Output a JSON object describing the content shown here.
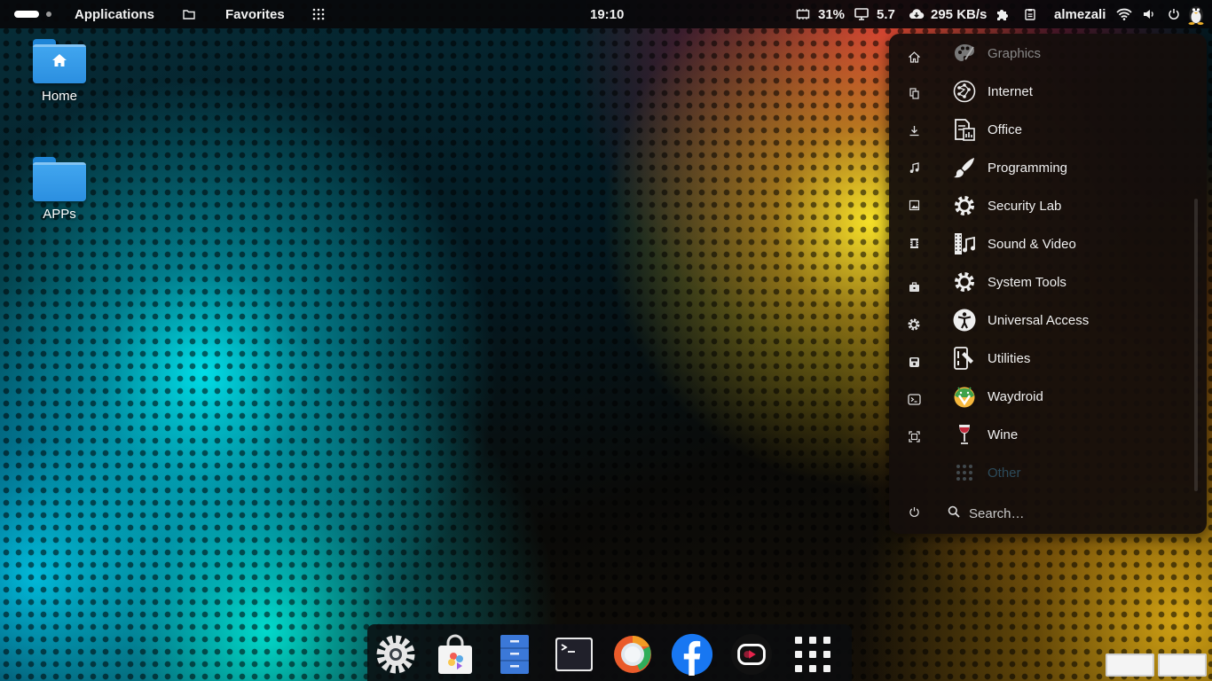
{
  "topbar": {
    "applications_label": "Applications",
    "favorites_label": "Favorites",
    "clock": "19:10",
    "battery_value": "31%",
    "display_value": "5.7",
    "network_speed": "295 KB/s",
    "username": "almezali"
  },
  "desktop": {
    "icons": [
      {
        "label": "Home"
      },
      {
        "label": "APPs"
      }
    ]
  },
  "menu": {
    "categories": [
      {
        "label": "Graphics",
        "icon": "palette-icon"
      },
      {
        "label": "Internet",
        "icon": "network-icon"
      },
      {
        "label": "Office",
        "icon": "office-icon"
      },
      {
        "label": "Programming",
        "icon": "brush-icon"
      },
      {
        "label": "Security Lab",
        "icon": "gear-icon"
      },
      {
        "label": "Sound & Video",
        "icon": "media-icon"
      },
      {
        "label": "System Tools",
        "icon": "gear-icon"
      },
      {
        "label": "Universal Access",
        "icon": "accessibility-icon"
      },
      {
        "label": "Utilities",
        "icon": "utilities-icon"
      },
      {
        "label": "Waydroid",
        "icon": "waydroid-icon"
      },
      {
        "label": "Wine",
        "icon": "wine-icon"
      },
      {
        "label": "Other",
        "icon": "grid-icon"
      }
    ],
    "search_placeholder": "Search…"
  },
  "dock": {
    "apps": [
      "settings-icon",
      "software-store-icon",
      "file-cabinet-icon",
      "terminal-icon",
      "browser-icon",
      "facebook-icon",
      "video-player-icon",
      "app-grid-icon"
    ]
  },
  "colors": {
    "accent_blue": "#2b8fe0",
    "facebook_blue": "#1877f2",
    "menu_bg": "#140e0c"
  }
}
